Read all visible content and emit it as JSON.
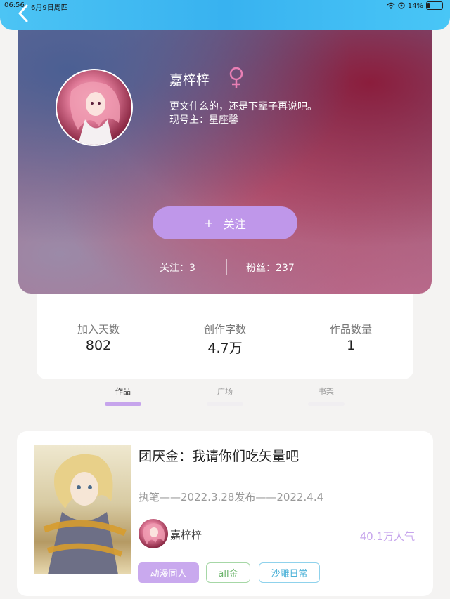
{
  "status_bar": {
    "time": "06:56",
    "date": "6月9日周四",
    "battery": "14%",
    "battery_level": 0.14
  },
  "profile": {
    "name": "嘉梓梓",
    "gender_icon": "female-icon",
    "bio_line1": "更文什么的，还是下辈子再说吧。",
    "bio_line2": "现号主：星座馨",
    "follow_button": {
      "icon": "+",
      "label": "关注"
    },
    "following": "关注：3",
    "fans": "粉丝：237"
  },
  "stats": [
    {
      "label": "加入天数",
      "value": "802"
    },
    {
      "label": "创作字数",
      "value": "4.7万"
    },
    {
      "label": "作品数量",
      "value": "1"
    }
  ],
  "tabs": [
    {
      "label": "作品",
      "active": true
    },
    {
      "label": "广场",
      "active": false
    },
    {
      "label": "书架",
      "active": false
    }
  ],
  "work": {
    "title": "团厌金：我请你们吃矢量吧",
    "dates": "执笔——2022.3.28发布——2022.4.4",
    "author": "嘉梓梓",
    "popularity": "40.1万人气",
    "tags": [
      "动漫同人",
      "all金",
      "沙雕日常"
    ]
  },
  "colors": {
    "accent_purple": "#bf97ea",
    "topbar_blue": "#38b2f0",
    "tag_green": "#6cb56c",
    "tag_blue": "#4cb2d8"
  }
}
